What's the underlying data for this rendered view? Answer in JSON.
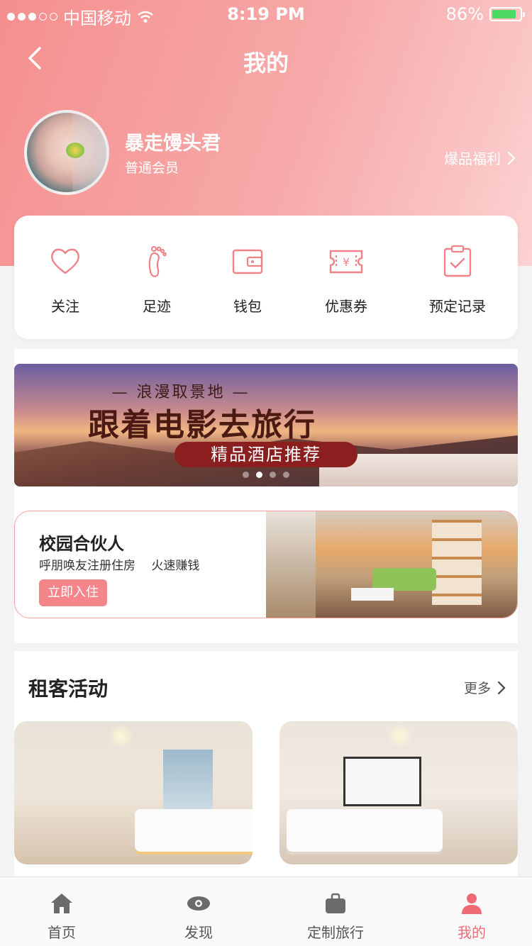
{
  "status_bar": {
    "carrier": "中国移动",
    "time": "8:19 PM",
    "battery": "86%",
    "battery_level": 0.86,
    "signal_bars": 3
  },
  "nav": {
    "title": "我的"
  },
  "profile": {
    "name": "暴走馒头君",
    "level": "普通会员",
    "perks_link": "爆品福利"
  },
  "quick_actions": [
    {
      "label": "关注",
      "icon": "heart-icon"
    },
    {
      "label": "足迹",
      "icon": "footprint-icon"
    },
    {
      "label": "钱包",
      "icon": "wallet-icon"
    },
    {
      "label": "优惠券",
      "icon": "coupon-icon"
    },
    {
      "label": "预定记录",
      "icon": "booking-record-icon"
    }
  ],
  "banner": {
    "subtitle": "— 浪漫取景地 —",
    "title": "跟着电影去旅行",
    "tag": "精品酒店推荐",
    "page_count": 4,
    "active_page": 1
  },
  "promo": {
    "title": "校园合伙人",
    "description": "呼朋唤友注册住房　 火速赚钱",
    "button": "立即入住"
  },
  "activities": {
    "title": "租客活动",
    "more": "更多"
  },
  "tabbar": {
    "items": [
      {
        "label": "首页",
        "icon": "home-icon"
      },
      {
        "label": "发现",
        "icon": "eye-icon"
      },
      {
        "label": "定制旅行",
        "icon": "suitcase-icon"
      },
      {
        "label": "我的",
        "icon": "person-icon"
      }
    ],
    "active_index": 3
  },
  "colors": {
    "accent": "#f06a75",
    "icon_pink": "#f08189",
    "header_start": "#f58f8f",
    "header_end": "#fcd2d2"
  }
}
